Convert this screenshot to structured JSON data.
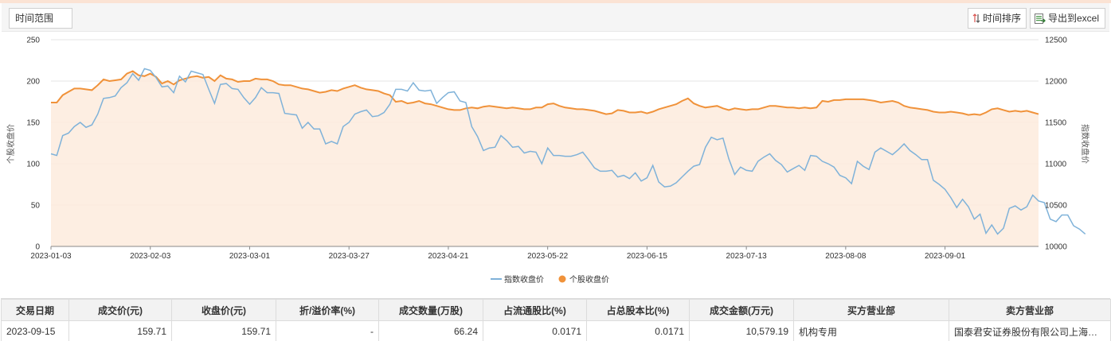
{
  "toolbar": {
    "time_range_label": "时间范围",
    "sort_label": "时间排序",
    "export_label": "导出到excel",
    "sort_icon": "sort-arrows-icon",
    "export_icon": "excel-export-icon"
  },
  "colors": {
    "index_line": "#7fb2d9",
    "stock_line": "#f0923a",
    "area_fill": "#fdebdd",
    "grid": "#e6e6e6"
  },
  "chart_data": {
    "type": "line",
    "left_axis_label": "个股收盘价",
    "right_axis_label": "指数收盘价",
    "left_ylim": [
      0,
      250
    ],
    "left_ticks": [
      0,
      50,
      100,
      150,
      200,
      250
    ],
    "right_ylim": [
      10000,
      12500
    ],
    "right_ticks": [
      10000,
      10500,
      11000,
      11500,
      12000,
      12500
    ],
    "x_tick_labels": [
      "2023-01-03",
      "2023-02-03",
      "2023-03-01",
      "2023-03-27",
      "2023-04-21",
      "2023-05-22",
      "2023-06-15",
      "2023-07-13",
      "2023-08-08",
      "2023-09-01"
    ],
    "x_tick_indices": [
      0,
      17,
      34,
      51,
      68,
      85,
      102,
      119,
      136,
      153
    ],
    "grid": "horizontal",
    "legend_position": "bottom-center",
    "series": [
      {
        "name": "指数收盘价",
        "axis": "right",
        "values": [
          11120,
          11100,
          11340,
          11370,
          11450,
          11500,
          11440,
          11470,
          11600,
          11790,
          11800,
          11820,
          11920,
          11980,
          12090,
          12010,
          12150,
          12130,
          12040,
          11930,
          11940,
          11860,
          12060,
          11990,
          12120,
          12100,
          12080,
          11900,
          11730,
          11960,
          11970,
          11910,
          11900,
          11800,
          11720,
          11800,
          11920,
          11860,
          11860,
          11850,
          11610,
          11600,
          11590,
          11430,
          11500,
          11420,
          11420,
          11240,
          11270,
          11240,
          11450,
          11500,
          11600,
          11630,
          11650,
          11570,
          11580,
          11620,
          11720,
          11900,
          11900,
          11880,
          11980,
          11890,
          11880,
          11890,
          11730,
          11800,
          11860,
          11870,
          11760,
          11740,
          11450,
          11330,
          11160,
          11190,
          11200,
          11340,
          11280,
          11200,
          11210,
          11130,
          11150,
          11140,
          11000,
          11190,
          11100,
          11100,
          11090,
          11090,
          11110,
          11140,
          11050,
          10950,
          10910,
          10910,
          10920,
          10840,
          10860,
          10820,
          10890,
          10790,
          10830,
          10980,
          10780,
          10720,
          10730,
          10770,
          10840,
          10910,
          10970,
          10990,
          11200,
          11320,
          11290,
          11310,
          11060,
          10870,
          10960,
          10920,
          10910,
          11030,
          11080,
          11120,
          11040,
          10990,
          10900,
          10940,
          10980,
          10920,
          11100,
          11090,
          11030,
          11000,
          10960,
          10860,
          10830,
          10760,
          11030,
          10970,
          10930,
          11140,
          11190,
          11150,
          11110,
          11170,
          11240,
          11160,
          11110,
          11050,
          11050,
          10800,
          10750,
          10690,
          10590,
          10470,
          10570,
          10480,
          10330,
          10390,
          10160,
          10260,
          10150,
          10220,
          10460,
          10490,
          10440,
          10480,
          10620,
          10550,
          10530,
          10330,
          10300,
          10380,
          10380,
          10250,
          10210,
          10150
        ]
      },
      {
        "name": "个股收盘价",
        "axis": "left",
        "values": [
          174,
          174,
          183,
          187,
          191,
          191,
          190,
          189,
          195,
          202,
          200,
          201,
          202,
          209,
          212,
          207,
          206,
          209,
          205,
          197,
          200,
          196,
          201,
          203,
          205,
          206,
          204,
          205,
          200,
          207,
          203,
          202,
          199,
          200,
          200,
          203,
          202,
          202,
          200,
          196,
          195,
          195,
          193,
          191,
          190,
          188,
          186,
          187,
          189,
          188,
          191,
          193,
          195,
          192,
          190,
          189,
          188,
          185,
          183,
          175,
          176,
          173,
          174,
          176,
          173,
          172,
          170,
          168,
          166,
          165,
          165,
          167,
          168,
          167,
          169,
          170,
          169,
          168,
          167,
          168,
          167,
          166,
          166,
          168,
          168,
          172,
          173,
          170,
          168,
          167,
          166,
          166,
          165,
          164,
          162,
          160,
          161,
          165,
          164,
          162,
          162,
          163,
          161,
          163,
          166,
          168,
          170,
          172,
          176,
          179,
          173,
          170,
          168,
          169,
          170,
          167,
          165,
          167,
          166,
          165,
          166,
          166,
          168,
          170,
          170,
          169,
          168,
          168,
          167,
          168,
          167,
          168,
          176,
          175,
          177,
          177,
          178,
          178,
          178,
          178,
          177,
          176,
          174,
          175,
          176,
          174,
          170,
          168,
          167,
          166,
          165,
          163,
          162,
          162,
          163,
          162,
          161,
          159,
          160,
          159,
          162,
          166,
          167,
          165,
          163,
          164,
          163,
          164,
          162,
          160
        ]
      }
    ]
  },
  "legend": {
    "index_label": "指数收盘价",
    "stock_label": "个股收盘价"
  },
  "table": {
    "headers": [
      "交易日期",
      "成交价(元)",
      "收盘价(元)",
      "折/溢价率(%)",
      "成交数量(万股)",
      "占流通股比(%)",
      "占总股本比(%)",
      "成交金额(万元)",
      "买方营业部",
      "卖方营业部"
    ],
    "rows": [
      [
        "2023-09-15",
        "159.71",
        "159.71",
        "-",
        "66.24",
        "0.0171",
        "0.0171",
        "10,579.19",
        "机构专用",
        "国泰君安证券股份有限公司上海分公司"
      ]
    ]
  }
}
